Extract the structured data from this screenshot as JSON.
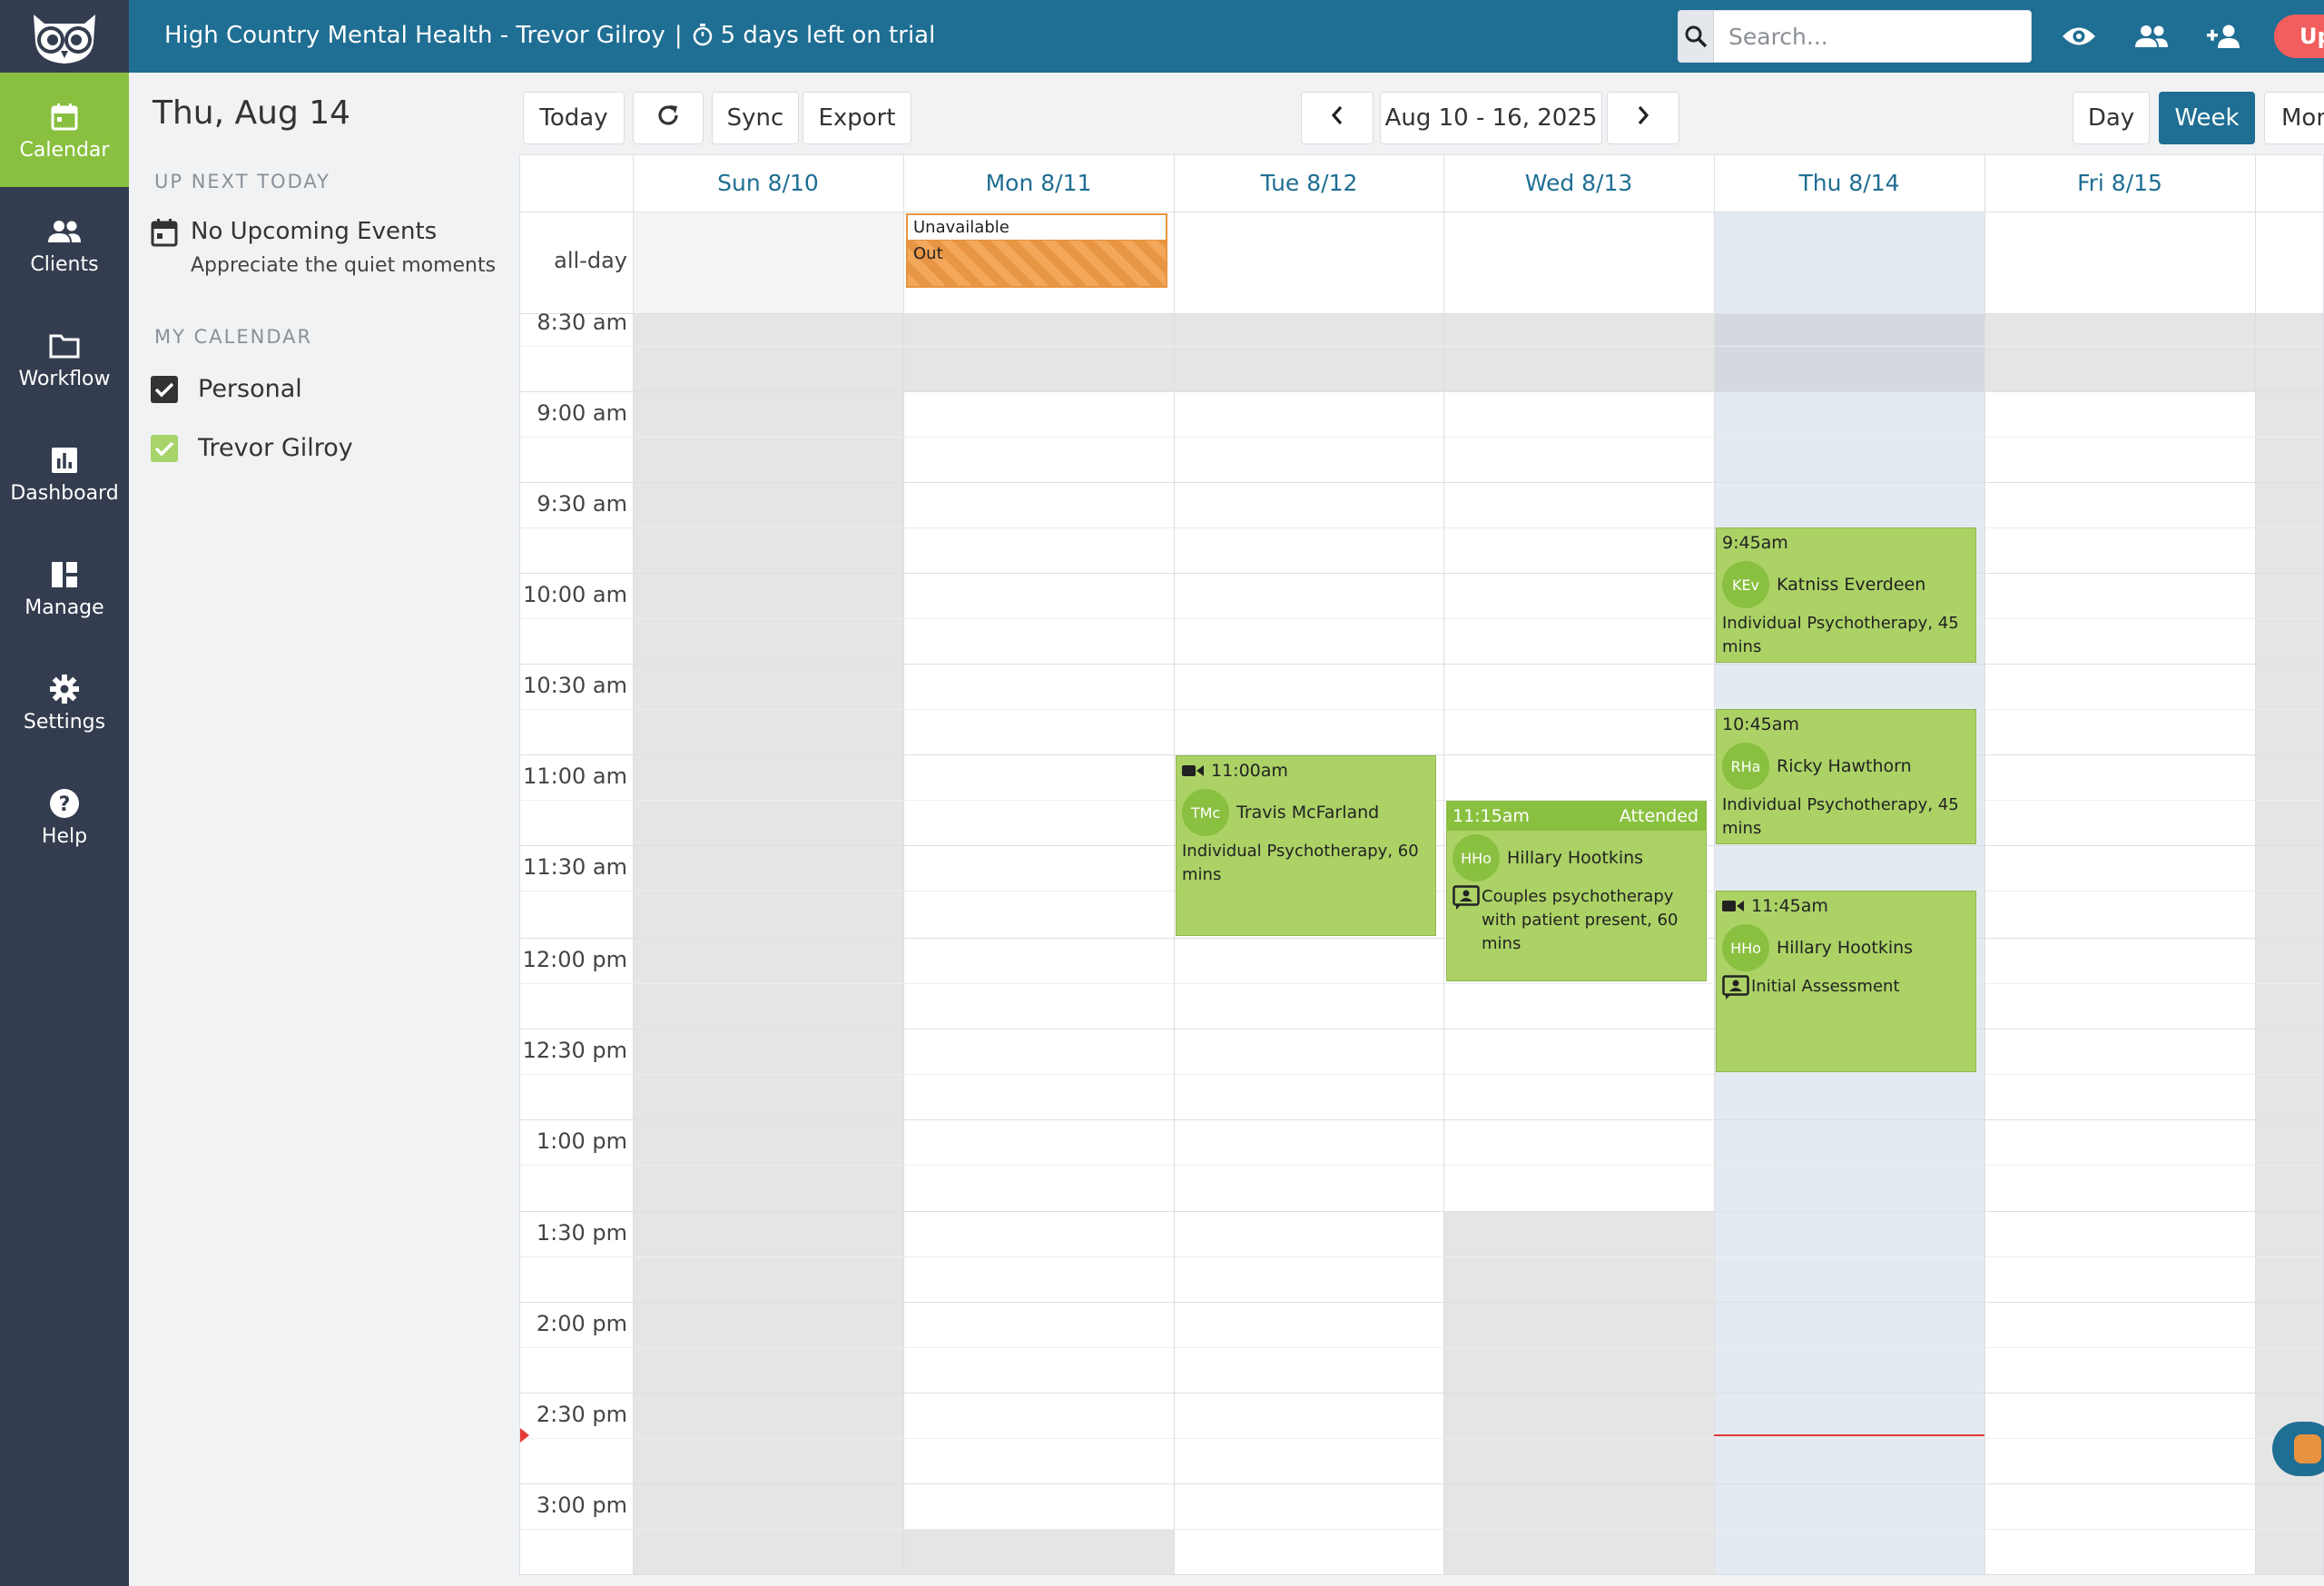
{
  "topbar": {
    "org_name": "High Country Mental Health - Trevor Gilroy",
    "separator": "|",
    "trial_text": "5 days left on trial",
    "search_placeholder": "Search...",
    "upgrade_label": "Up",
    "icons": [
      "search-icon",
      "eye-icon",
      "clients-icon",
      "add-user-icon"
    ]
  },
  "nav": {
    "items": [
      {
        "label": "Calendar",
        "icon": "calendar-icon",
        "active": true
      },
      {
        "label": "Clients",
        "icon": "clients-icon"
      },
      {
        "label": "Workflow",
        "icon": "folder-icon"
      },
      {
        "label": "Dashboard",
        "icon": "chart-icon"
      },
      {
        "label": "Manage",
        "icon": "manage-icon"
      },
      {
        "label": "Settings",
        "icon": "gear-icon"
      },
      {
        "label": "Help",
        "icon": "help-icon"
      }
    ]
  },
  "sidepanel": {
    "date": "Thu, Aug 14",
    "up_next_heading": "UP NEXT TODAY",
    "no_events_title": "No Upcoming Events",
    "no_events_sub": "Appreciate the quiet moments",
    "my_calendar_heading": "MY CALENDAR",
    "calendars": [
      {
        "label": "Personal",
        "color": "#333333",
        "checked": true
      },
      {
        "label": "Trevor Gilroy",
        "color": "#a6d36a",
        "checked": true
      }
    ]
  },
  "toolbar": {
    "today": "Today",
    "sync": "Sync",
    "export": "Export",
    "range": "Aug 10 - 16, 2025",
    "view_day": "Day",
    "view_week": "Week",
    "view_month": "Mon"
  },
  "calendar": {
    "days": [
      "Sun 8/10",
      "Mon 8/11",
      "Tue 8/12",
      "Wed 8/13",
      "Thu 8/14",
      "Fri 8/15"
    ],
    "allday_label": "all-day",
    "times": [
      "8:30 am",
      "9:00 am",
      "9:30 am",
      "10:00 am",
      "10:30 am",
      "11:00 am",
      "11:30 am",
      "12:00 pm",
      "12:30 pm",
      "1:00 pm",
      "1:30 pm",
      "2:00 pm",
      "2:30 pm",
      "3:00 pm"
    ],
    "allday_event": {
      "title": "Unavailable",
      "subtitle": "Out"
    },
    "events": [
      {
        "time": "11:00am",
        "video": true,
        "initials": "TMc",
        "client": "Travis McFarland",
        "service": "Individual Psychotherapy, 60 mins"
      },
      {
        "time": "11:15am",
        "status": "Attended",
        "initials": "HHo",
        "client": "Hillary Hootkins",
        "service": "Couples psychotherapy with patient present, 60 mins"
      },
      {
        "time": "9:45am",
        "initials": "KEv",
        "client": "Katniss Everdeen",
        "service": "Individual Psychotherapy, 45 mins"
      },
      {
        "time": "10:45am",
        "initials": "RHa",
        "client": "Ricky Hawthorn",
        "service": "Individual Psychotherapy, 45 mins"
      },
      {
        "time": "11:45am",
        "video": true,
        "initials": "HHo",
        "client": "Hillary Hootkins",
        "service": "Initial Assessment"
      }
    ]
  },
  "colors": {
    "topbar": "#1f6e93",
    "nav_bg": "#343d4f",
    "nav_active": "#8ac040",
    "event_green": "#acd266",
    "unavailable": "#f2a75a",
    "now_line": "#e53935"
  }
}
